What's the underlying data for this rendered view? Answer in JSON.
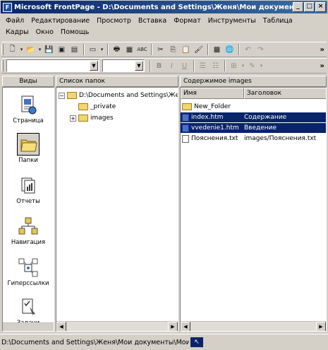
{
  "window": {
    "title": "Microsoft FrontPage - D:\\Documents and Settings\\Женя\\Мои документы\\"
  },
  "titlebar_buttons": {
    "minimize": "_",
    "maximize": "□",
    "close": "×"
  },
  "menu": {
    "row1": [
      "Файл",
      "Редактирование",
      "Просмотр",
      "Вставка",
      "Формат",
      "Инструменты",
      "Таблица"
    ],
    "row2": [
      "Кадры",
      "Окно",
      "Помощь"
    ]
  },
  "views_pane": {
    "header": "Виды",
    "items": [
      {
        "label": "Страница",
        "icon": "page-view-icon"
      },
      {
        "label": "Папки",
        "icon": "folders-view-icon",
        "selected": true
      },
      {
        "label": "Отчеты",
        "icon": "reports-view-icon"
      },
      {
        "label": "Навигация",
        "icon": "navigation-view-icon"
      },
      {
        "label": "Гиперссылки",
        "icon": "hyperlinks-view-icon"
      },
      {
        "label": "Задачи",
        "icon": "tasks-view-icon"
      }
    ]
  },
  "folders_pane": {
    "header": "Список папок",
    "root": "D:\\Documents and Settings\\Женя",
    "children": [
      "_private",
      "images"
    ]
  },
  "content_pane": {
    "header": "Содержимое images",
    "columns": [
      "Имя",
      "Заголовок"
    ],
    "rows": [
      {
        "name": "New_Folder",
        "title": "",
        "type": "folder"
      },
      {
        "name": "index.htm",
        "title": "Содержание",
        "type": "htm",
        "selected": true
      },
      {
        "name": "vvedenie1.htm",
        "title": "Введение",
        "type": "htm",
        "selected": true
      },
      {
        "name": "Пояснения.txt",
        "title": "images/Пояснения.txt",
        "type": "txt"
      }
    ]
  },
  "status": {
    "text": "D:\\Documents and Settings\\Женя\\Мои документы\\Мои Web"
  },
  "colors": {
    "selection": "#0a246a",
    "face": "#d4d0c8"
  }
}
